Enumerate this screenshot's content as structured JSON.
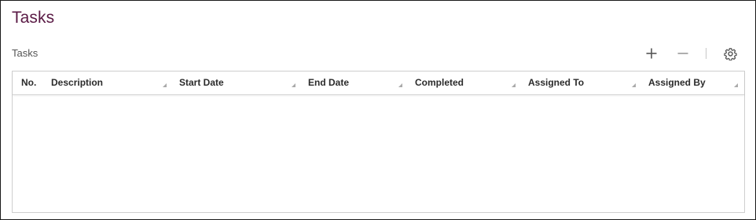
{
  "page": {
    "title": "Tasks"
  },
  "section": {
    "label": "Tasks"
  },
  "toolbar": {
    "add_icon": "plus-icon",
    "remove_icon": "minus-icon",
    "settings_icon": "gear-icon"
  },
  "grid": {
    "columns": [
      {
        "key": "no",
        "label": "No."
      },
      {
        "key": "description",
        "label": "Description"
      },
      {
        "key": "start_date",
        "label": "Start Date"
      },
      {
        "key": "end_date",
        "label": "End Date"
      },
      {
        "key": "completed",
        "label": "Completed"
      },
      {
        "key": "assigned_to",
        "label": "Assigned To"
      },
      {
        "key": "assigned_by",
        "label": "Assigned By"
      }
    ],
    "rows": []
  },
  "colors": {
    "title": "#5a1a45",
    "text": "#2b2b2b",
    "border": "#cfcfcf"
  }
}
